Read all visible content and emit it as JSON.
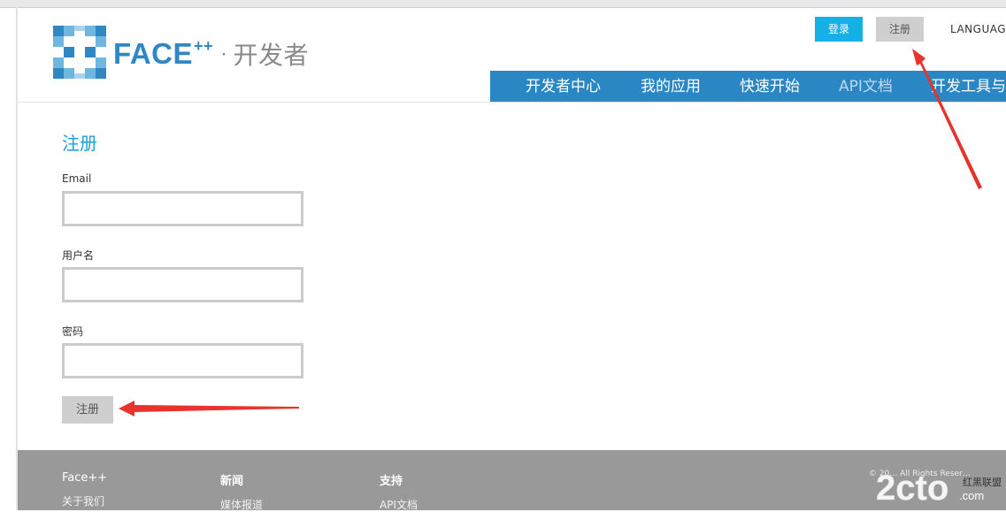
{
  "header": {
    "logo_brand": "FACE",
    "logo_plus": "++",
    "logo_separator": "·",
    "logo_suffix": "开发者",
    "login_label": "登录",
    "register_label": "注册",
    "language_label": "LANGUAGE"
  },
  "nav": {
    "items": [
      {
        "label": "开发者中心"
      },
      {
        "label": "我的应用"
      },
      {
        "label": "快速开始"
      },
      {
        "label": "API文档"
      },
      {
        "label": "开发工具与"
      }
    ]
  },
  "form": {
    "title": "注册",
    "email_label": "Email",
    "email_value": "",
    "username_label": "用户名",
    "username_value": "",
    "password_label": "密码",
    "password_value": "",
    "submit_label": "注册"
  },
  "footer": {
    "columns": [
      {
        "heading": "Face++",
        "link": "关于我们"
      },
      {
        "heading": "新闻",
        "link": "媒体报道"
      },
      {
        "heading": "支持",
        "link": "API文档"
      }
    ],
    "copyright": "© 20… All Rights Reser…"
  },
  "watermark": {
    "text": "2cto",
    "suffix": ".com",
    "badge": "红黑联盟"
  },
  "colors": {
    "brand_blue": "#2f87c4",
    "nav_bg": "#2b87c3",
    "login_bg": "#14b0e6",
    "title_blue": "#1aa0d8",
    "footer_bg": "#999999",
    "annotation_red": "#e8322c"
  },
  "icons": {
    "logo": "face-plus-plus-logo-icon",
    "arrow": "red-annotation-arrow-icon"
  }
}
